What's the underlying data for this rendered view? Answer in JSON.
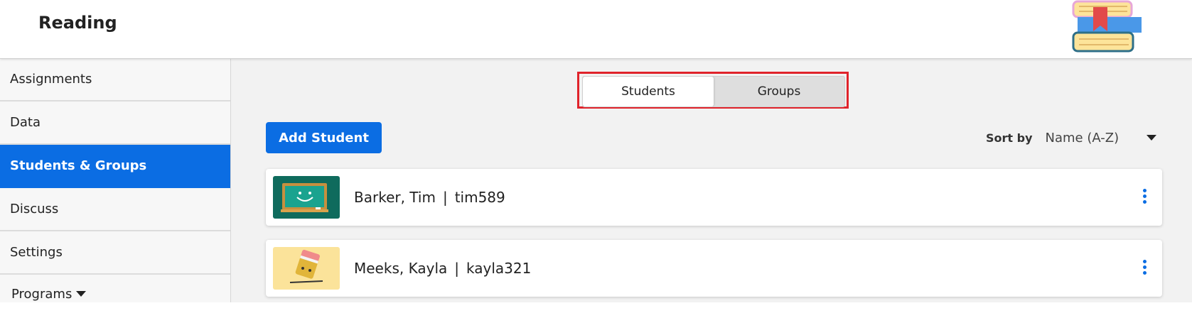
{
  "header": {
    "title": "Reading",
    "logo_icon": "books-stack-icon"
  },
  "sidebar": {
    "items": [
      {
        "label": "Assignments",
        "active": false
      },
      {
        "label": "Data",
        "active": false
      },
      {
        "label": "Students & Groups",
        "active": true
      },
      {
        "label": "Discuss",
        "active": false
      },
      {
        "label": "Settings",
        "active": false
      }
    ],
    "programs_label": "Programs"
  },
  "tabs": {
    "students": "Students",
    "groups": "Groups",
    "selected": "Students"
  },
  "toolbar": {
    "add_label": "Add Student"
  },
  "sort": {
    "label": "Sort by",
    "value": "Name (A-Z)"
  },
  "students": [
    {
      "name": "Barker, Tim",
      "separator": "|",
      "username": "tim589",
      "avatar": "chalkboard-smile-icon"
    },
    {
      "name": "Meeks, Kayla",
      "separator": "|",
      "username": "kayla321",
      "avatar": "pencil-eraser-icon"
    }
  ],
  "colors": {
    "primary": "#0b6de3",
    "highlight": "#e0232b",
    "chalkboard_bg": "#0f6b5d",
    "pencil_bg": "#fbe39a"
  }
}
